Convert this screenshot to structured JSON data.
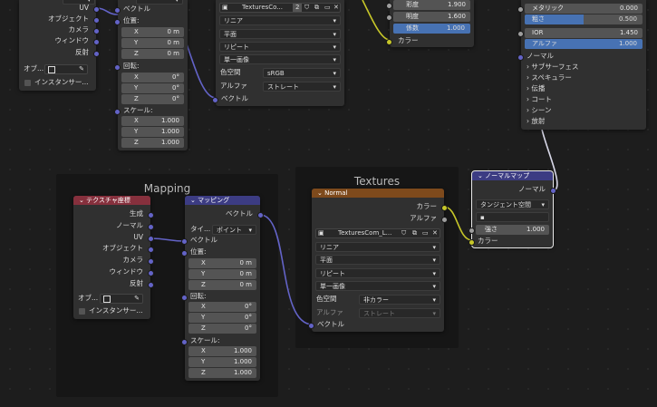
{
  "tc_top": {
    "outputs": [
      "UV",
      "オブジェクト",
      "カメラ",
      "ウィンドウ",
      "反射"
    ],
    "object_label": "オブ...",
    "instancer_label": "インスタンサー..."
  },
  "map_top": {
    "vector_label": "ベクトル",
    "location_label": "位置:",
    "loc": [
      {
        "axis": "X",
        "val": "0 m"
      },
      {
        "axis": "Y",
        "val": "0 m"
      },
      {
        "axis": "Z",
        "val": "0 m"
      }
    ],
    "rotation_label": "回転:",
    "rot": [
      {
        "axis": "X",
        "val": "0°"
      },
      {
        "axis": "Y",
        "val": "0°"
      },
      {
        "axis": "Z",
        "val": "0°"
      }
    ],
    "scale_label": "スケール:",
    "scale": [
      {
        "axis": "X",
        "val": "1.000"
      },
      {
        "axis": "Y",
        "val": "1.000"
      },
      {
        "axis": "Z",
        "val": "1.000"
      }
    ]
  },
  "img_top": {
    "image_name": "TexturesCo...",
    "users": "2",
    "interp": "リニア",
    "proj": "平面",
    "ext": "リピート",
    "source": "単一画像",
    "colorspace_label": "色空間",
    "colorspace": "sRGB",
    "alpha_label": "アルファ",
    "alpha": "ストレート",
    "vector_label": "ベクトル"
  },
  "hsv": {
    "sat_label": "彩度",
    "sat": "1.900",
    "val_label": "明度",
    "val": "1.600",
    "fac_label": "係数",
    "fac": "1.000",
    "color_label": "カラー"
  },
  "bsdf": {
    "metal_label": "メタリック",
    "metal": "0.000",
    "rough_label": "粗さ",
    "rough": "0.500",
    "rough_fill": 0.5,
    "ior_label": "IOR",
    "ior": "1.450",
    "alpha_label": "アルファ",
    "alpha": "1.000",
    "alpha_fill": 1.0,
    "normal_label": "ノーマル",
    "sections": [
      "サブサーフェス",
      "スペキュラー",
      "伝播",
      "コート",
      "シーン",
      "放射"
    ]
  },
  "frame_mapping": {
    "title": "Mapping"
  },
  "frame_textures": {
    "title": "Textures"
  },
  "tc": {
    "header": "テクスチャ座標",
    "outputs": [
      "生成",
      "ノーマル",
      "UV",
      "オブジェクト",
      "カメラ",
      "ウィンドウ",
      "反射"
    ],
    "object_label": "オブ...",
    "instancer_label": "インスタンサー..."
  },
  "mapping": {
    "header": "マッピング",
    "vector_out": "ベクトル",
    "type_label": "タイ...",
    "type": "ポイント",
    "vector_in": "ベクトル",
    "location_label": "位置:",
    "loc": [
      {
        "axis": "X",
        "val": "0 m"
      },
      {
        "axis": "Y",
        "val": "0 m"
      },
      {
        "axis": "Z",
        "val": "0 m"
      }
    ],
    "rotation_label": "回転:",
    "rot": [
      {
        "axis": "X",
        "val": "0°"
      },
      {
        "axis": "Y",
        "val": "0°"
      },
      {
        "axis": "Z",
        "val": "0°"
      }
    ],
    "scale_label": "スケール:",
    "scale": [
      {
        "axis": "X",
        "val": "1.000"
      },
      {
        "axis": "Y",
        "val": "1.000"
      },
      {
        "axis": "Z",
        "val": "1.000"
      }
    ]
  },
  "tex": {
    "header": "Normal",
    "color_out": "カラー",
    "alpha_out": "アルファ",
    "image_name": "TexturesCom_L...",
    "interp": "リニア",
    "proj": "平面",
    "ext": "リピート",
    "source": "単一画像",
    "colorspace_label": "色空間",
    "colorspace": "非カラー",
    "alpha_label": "アルファ",
    "alpha": "ストレート",
    "vector_label": "ベクトル"
  },
  "nmap": {
    "header": "ノーマルマップ",
    "normal_out": "ノーマル",
    "space": "タンジェント空間",
    "uv_placeholder": "",
    "strength_label": "強さ",
    "strength": "1.000",
    "color_label": "カラー"
  },
  "colors": {
    "vector": "#6363c7",
    "color": "#c7c729",
    "grey": "#9e9e9e",
    "link_white": "#d8d8e8"
  }
}
